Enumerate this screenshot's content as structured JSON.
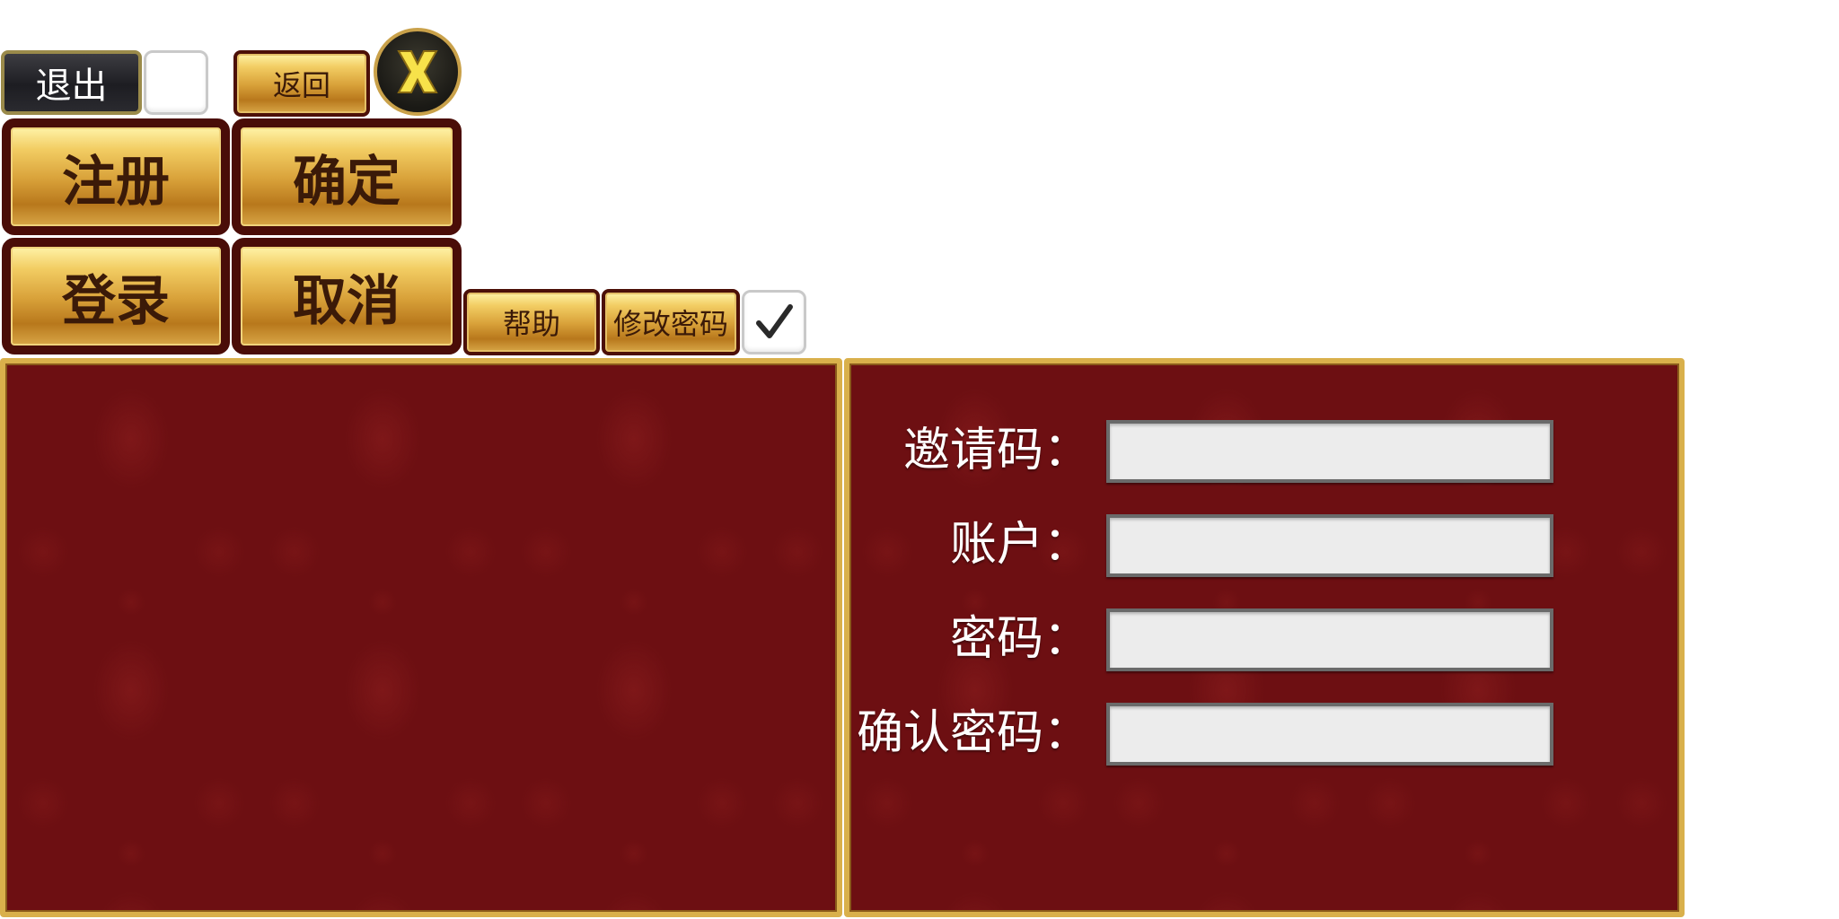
{
  "toolbar": {
    "exit_label": "退出",
    "back_label": "返回",
    "close_icon": "close-x-icon"
  },
  "main_buttons": {
    "register_label": "注册",
    "confirm_label": "确定",
    "login_label": "登录",
    "cancel_label": "取消"
  },
  "secondary_buttons": {
    "help_label": "帮助",
    "change_password_label": "修改密码",
    "checkbox_checked": true
  },
  "register_form": {
    "invite_code_label": "邀请码：",
    "account_label": "账户：",
    "password_label": "密码：",
    "confirm_password_label": "确认密码：",
    "invite_code_value": "",
    "account_value": "",
    "password_value": "",
    "confirm_password_value": ""
  },
  "colors": {
    "panel_background": "#6d0f12",
    "panel_border": "#d9b04b",
    "button_gold": "#e0ad48",
    "button_border": "#4a0d08"
  }
}
